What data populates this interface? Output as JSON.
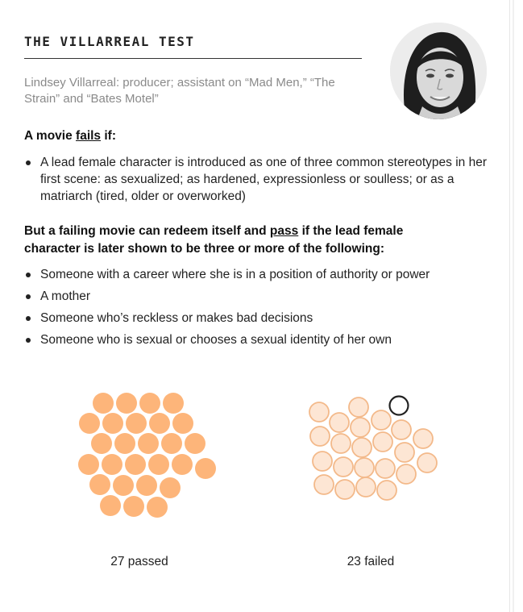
{
  "header": {
    "title": "THE VILLARREAL TEST",
    "subtitle": "Lindsey Villarreal: producer; assistant on “Mad Men,” “The Strain” and “Bates Motel”"
  },
  "fail_section": {
    "prefix": "A movie ",
    "keyword": "fails",
    "suffix": " if:",
    "items": [
      "A lead female character is introduced as one of three common stereotypes in her first scene: as sexualized; as hardened, expressionless or soulless; or as a matriarch (tired, older or overworked)"
    ]
  },
  "pass_section": {
    "prefix": "But a failing movie can redeem itself and ",
    "keyword": "pass",
    "suffix": " if the lead female character is later shown to be three or more of the following:",
    "items": [
      "Someone with a career where she is in a position of authority or power",
      "A mother",
      "Someone who’s reckless or makes bad decisions",
      "Someone who is sexual or chooses a sexual identity of her own"
    ]
  },
  "results": {
    "passed_count": 27,
    "failed_count": 23,
    "passed_label": "27 passed",
    "failed_label": "23 failed",
    "passed_color": "#fdb57a",
    "failed_fill": "#fde6d4",
    "failed_stroke": "#f3b98a",
    "highlight_stroke": "#222222"
  }
}
